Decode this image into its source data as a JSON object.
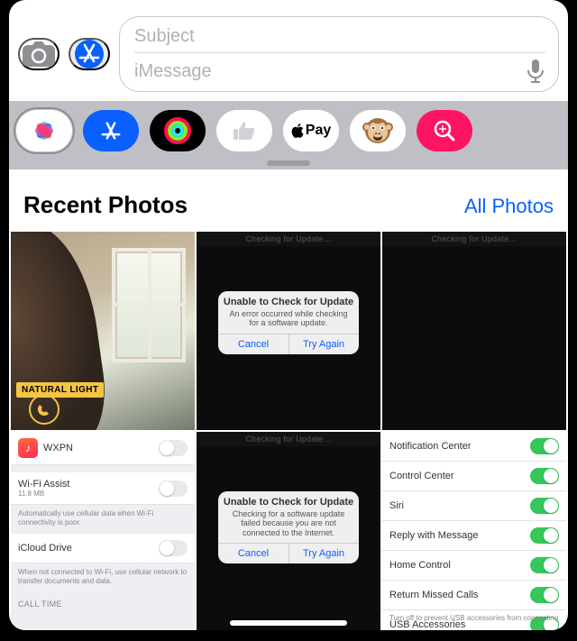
{
  "compose": {
    "subject_placeholder": "Subject",
    "message_placeholder": "iMessage"
  },
  "tray": {
    "apps": [
      {
        "name": "photos-app",
        "selected": true
      },
      {
        "name": "appstore-app",
        "selected": false
      },
      {
        "name": "activity-app",
        "selected": false
      },
      {
        "name": "digital-touch-app",
        "selected": false
      },
      {
        "name": "apple-pay-app",
        "selected": false,
        "label": "Pay"
      },
      {
        "name": "animoji-app",
        "selected": false
      },
      {
        "name": "images-app",
        "selected": false
      }
    ]
  },
  "section": {
    "title": "Recent Photos",
    "link": "All Photos"
  },
  "thumbs": {
    "photo_badge": "NATURAL LIGHT",
    "checking_text": "Checking for Update…",
    "dialog1": {
      "title": "Unable to Check for Update",
      "body": "An error occurred while checking for a software update.",
      "cancel": "Cancel",
      "retry": "Try Again"
    },
    "dialog2": {
      "title": "Unable to Check for Update",
      "body": "Checking for a software update failed because you are not connected to the Internet.",
      "cancel": "Cancel",
      "retry": "Try Again"
    },
    "settings_left": {
      "row1_label": "WXPN",
      "row2_label": "Wi-Fi Assist",
      "row2_detail": "11.8 MB",
      "row2_sub": "Automatically use cellular data when Wi-Fi connectivity is poor.",
      "row3_label": "iCloud Drive",
      "row3_sub": "When not connected to Wi-Fi, use cellular network to transfer documents and data.",
      "group_label": "CALL TIME"
    },
    "settings_right": {
      "items": [
        {
          "label": "Notification Center",
          "on": true
        },
        {
          "label": "Control Center",
          "on": true
        },
        {
          "label": "Siri",
          "on": true
        },
        {
          "label": "Reply with Message",
          "on": true
        },
        {
          "label": "Home Control",
          "on": true
        },
        {
          "label": "Return Missed Calls",
          "on": true
        },
        {
          "label": "USB Accessories",
          "on": true
        }
      ],
      "footer": "Turn off to prevent USB accessories from connecting"
    }
  }
}
